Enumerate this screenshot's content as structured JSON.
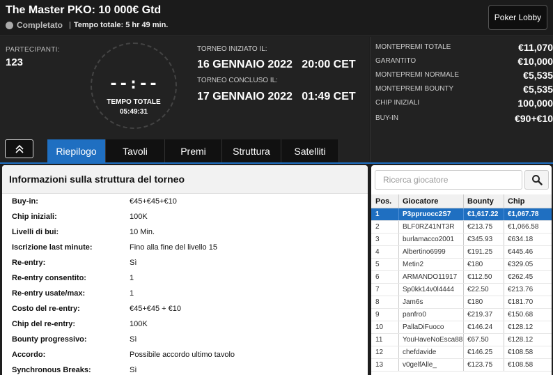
{
  "header": {
    "title": "The Master PKO: 10 000€ Gtd",
    "status": "Completato",
    "separator": "|",
    "total_time_text": "Tempo totale: 5 hr 49 min.",
    "lobby_button": "Poker Lobby"
  },
  "info": {
    "participants_label": "PARTECIPANTI:",
    "participants_value": "123",
    "clock_digits": "--:--",
    "clock_label": "TEMPO TOTALE",
    "clock_time": "05:49:31",
    "start_label": "TORNEO INIZIATO IL:",
    "start_value": "16 GENNAIO 2022   20:00 CET",
    "end_label": "TORNEO CONCLUSO IL:",
    "end_value": "17 GENNAIO 2022   01:49 CET"
  },
  "tabs": [
    {
      "label": "Riepilogo",
      "active": true
    },
    {
      "label": "Tavoli",
      "active": false
    },
    {
      "label": "Premi",
      "active": false
    },
    {
      "label": "Struttura",
      "active": false
    },
    {
      "label": "Satelliti",
      "active": false
    }
  ],
  "prize": [
    {
      "label": "MONTEPREMI TOTALE",
      "value": "€11,070"
    },
    {
      "label": "GARANTITO",
      "value": "€10,000"
    },
    {
      "label": "MONTEPREMI NORMALE",
      "value": "€5,535"
    },
    {
      "label": "MONTEPREMI BOUNTY",
      "value": "€5,535"
    },
    {
      "label": "CHIP INIZIALI",
      "value": "100,000"
    },
    {
      "label": "BUY-IN",
      "value": "€90+€10"
    }
  ],
  "structure": {
    "title": "Informazioni sulla struttura del torneo",
    "rows": [
      {
        "key": "Buy-in:",
        "value": "€45+€45+€10"
      },
      {
        "key": "Chip iniziali:",
        "value": "100K"
      },
      {
        "key": "Livelli di bui:",
        "value": "10 Min."
      },
      {
        "key": "Iscrizione last minute:",
        "value": "Fino alla fine del livello 15"
      },
      {
        "key": "Re-entry:",
        "value": "Sì"
      },
      {
        "key": "Re-entry consentito:",
        "value": "1"
      },
      {
        "key": "Re-entry usate/max:",
        "value": "1"
      },
      {
        "key": "Costo del re-entry:",
        "value": "€45+€45 + €10"
      },
      {
        "key": "Chip del re-entry:",
        "value": "100K"
      },
      {
        "key": "Bounty progressivo:",
        "value": "Sì"
      },
      {
        "key": "Accordo:",
        "value": "Possibile accordo ultimo tavolo"
      },
      {
        "key": "Synchronous Breaks:",
        "value": "Sì"
      }
    ]
  },
  "players": {
    "search_placeholder": "Ricerca giocatore",
    "columns": [
      "Pos.",
      "Giocatore",
      "Bounty",
      "Chip"
    ],
    "rows": [
      {
        "pos": "1",
        "name": "P3ppruocc2S7",
        "bounty": "€1,617.22",
        "chip": "€1,067.78",
        "selected": true
      },
      {
        "pos": "2",
        "name": "BLF0RZ41NT3R",
        "bounty": "€213.75",
        "chip": "€1,066.58"
      },
      {
        "pos": "3",
        "name": "burlamacco2001",
        "bounty": "€345.93",
        "chip": "€634.18"
      },
      {
        "pos": "4",
        "name": "Albertino6999",
        "bounty": "€191.25",
        "chip": "€445.46"
      },
      {
        "pos": "5",
        "name": "Metin2",
        "bounty": "€180",
        "chip": "€329.05"
      },
      {
        "pos": "6",
        "name": "ARMANDO11917",
        "bounty": "€112.50",
        "chip": "€262.45"
      },
      {
        "pos": "7",
        "name": "Sp0kk14v0l4444",
        "bounty": "€22.50",
        "chip": "€213.76"
      },
      {
        "pos": "8",
        "name": "Jam6s",
        "bounty": "€180",
        "chip": "€181.70"
      },
      {
        "pos": "9",
        "name": "panfro0",
        "bounty": "€219.37",
        "chip": "€150.68"
      },
      {
        "pos": "10",
        "name": "PallaDiFuoco",
        "bounty": "€146.24",
        "chip": "€128.12"
      },
      {
        "pos": "11",
        "name": "YouHaveNoEsca88",
        "bounty": "€67.50",
        "chip": "€128.12"
      },
      {
        "pos": "12",
        "name": "chefdavide",
        "bounty": "€146.25",
        "chip": "€108.58"
      },
      {
        "pos": "13",
        "name": "v0gelfAlle_",
        "bounty": "€123.75",
        "chip": "€108.58"
      }
    ]
  },
  "colors": {
    "accent": "#1f6fc1",
    "panel": "#222222"
  },
  "icons": {
    "status": "status-dot-icon",
    "collapse": "double-chevron-up-icon",
    "search": "search-icon"
  }
}
